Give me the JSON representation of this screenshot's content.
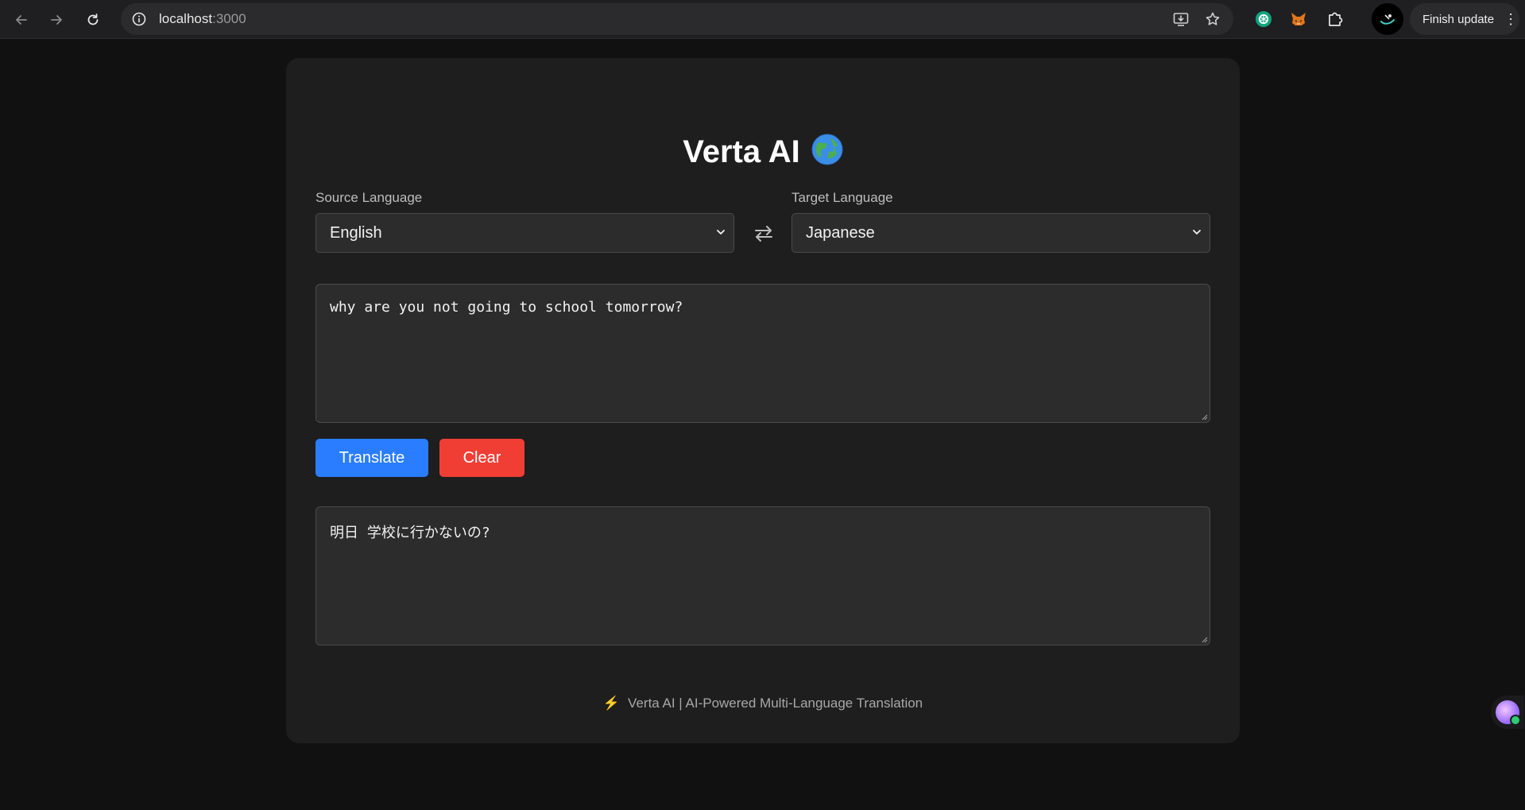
{
  "browser": {
    "url_host": "localhost",
    "url_port": ":3000",
    "finish_update_label": "Finish update"
  },
  "app": {
    "title": "Verta AI",
    "title_emoji": "globe-icon"
  },
  "source": {
    "label": "Source Language",
    "selected": "English"
  },
  "target": {
    "label": "Target Language",
    "selected": "Japanese"
  },
  "input_text": "why are you not going to school tomorrow?",
  "output_text": "明日 学校に行かないの?",
  "buttons": {
    "translate": "Translate",
    "clear": "Clear"
  },
  "footer": {
    "text": "Verta AI | AI-Powered Multi-Language Translation"
  },
  "colors": {
    "translate_button": "#2a7dff",
    "clear_button": "#f13e35",
    "footer_bolt": "#ff7a3d"
  }
}
